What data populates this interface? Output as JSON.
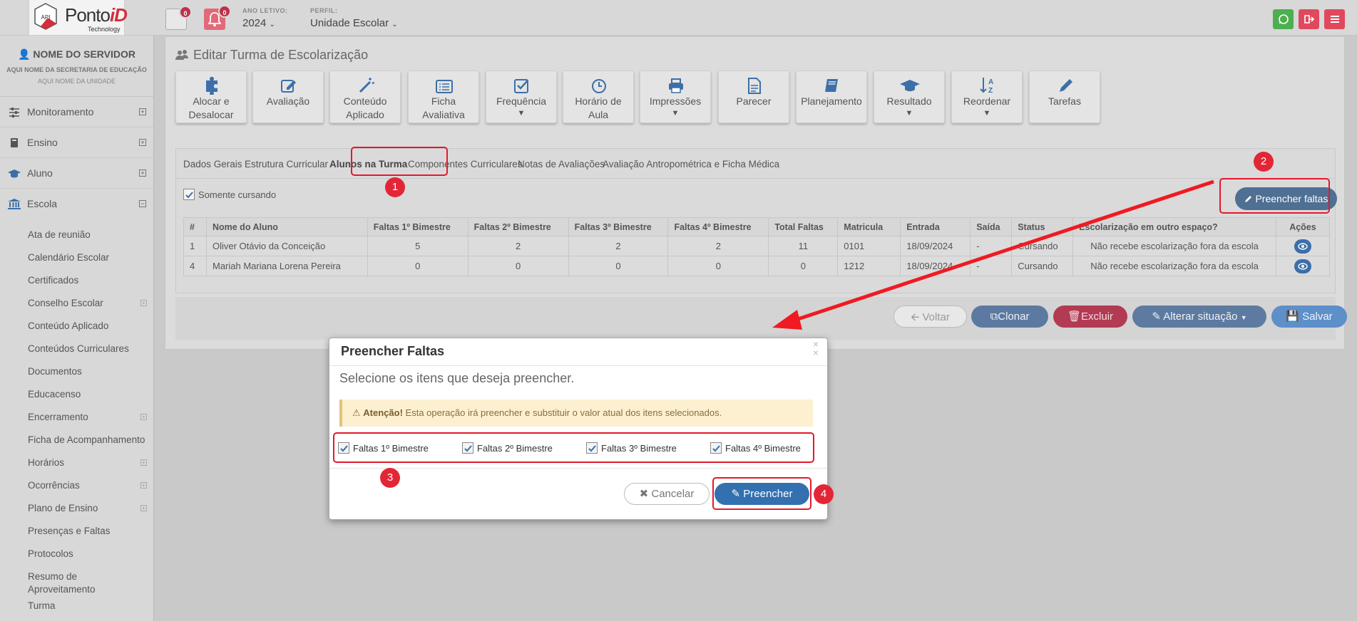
{
  "header": {
    "logo_brand": "Ponto",
    "logo_brand_accent": "iD",
    "logo_sub": "Technology",
    "logo_mark": "API",
    "msg_count": "0",
    "notif_count": "0",
    "year_label": "ANO LETIVO:",
    "year_value": "2024",
    "profile_label": "PERFIL:",
    "profile_value": "Unidade Escolar"
  },
  "sidebar": {
    "user_name": "NOME DO SERVIDOR",
    "secretaria": "AQUI NOME DA SECRETARIA DE EDUCAÇÃO",
    "unidade": "AQUI NOME DA UNIDADE",
    "menu": [
      {
        "label": "Monitoramento",
        "icon": "sliders-icon"
      },
      {
        "label": "Ensino",
        "icon": "book-icon"
      },
      {
        "label": "Aluno",
        "icon": "graduation-cap-icon"
      },
      {
        "label": "Escola",
        "icon": "bank-icon"
      }
    ],
    "submenu": [
      "Ata de reunião",
      "Calendário Escolar",
      "Certificados",
      "Conselho Escolar",
      "Conteúdo Aplicado",
      "Conteúdos Curriculares",
      "Documentos",
      "Educacenso",
      "Encerramento",
      "Ficha de Acompanhamento",
      "Horários",
      "Ocorrências",
      "Plano de Ensino",
      "Presenças e Faltas",
      "Protocolos",
      "Resumo de Aproveitamento",
      "Turma"
    ]
  },
  "page": {
    "title": "Editar Turma de Escolarização",
    "toolbar": [
      {
        "l1": "Alocar e",
        "l2": "Desalocar"
      },
      {
        "l1": "Avaliação",
        "l2": ""
      },
      {
        "l1": "Conteúdo",
        "l2": "Aplicado"
      },
      {
        "l1": "Ficha",
        "l2": "Avaliativa"
      },
      {
        "l1": "Frequência",
        "l2": ""
      },
      {
        "l1": "Horário de",
        "l2": "Aula"
      },
      {
        "l1": "Impressões",
        "l2": ""
      },
      {
        "l1": "Parecer",
        "l2": ""
      },
      {
        "l1": "Planejamento",
        "l2": ""
      },
      {
        "l1": "Resultado",
        "l2": ""
      },
      {
        "l1": "Reordenar",
        "l2": ""
      },
      {
        "l1": "Tarefas",
        "l2": ""
      }
    ],
    "tabs": [
      "Dados Gerais",
      "Estrutura Curricular",
      "Alunos na Turma",
      "Componentes Curriculares",
      "Notas de Avaliações",
      "Avaliação Antropométrica e Ficha Médica"
    ],
    "only_enrolled": "Somente cursando",
    "fill_absences_button": "Preencher faltas",
    "table": {
      "headers": [
        "#",
        "Nome do Aluno",
        "Faltas 1º Bimestre",
        "Faltas 2º Bimestre",
        "Faltas 3º Bimestre",
        "Faltas 4º Bimestre",
        "Total Faltas",
        "Matricula",
        "Entrada",
        "Saída",
        "Status",
        "Escolarização em outro espaço?",
        "Ações"
      ],
      "rows": [
        [
          "1",
          "Oliver Otávio da Conceição",
          "5",
          "2",
          "2",
          "2",
          "11",
          "0101",
          "18/09/2024",
          "-",
          "Cursando",
          "Não recebe escolarização fora da escola"
        ],
        [
          "4",
          "Mariah Mariana Lorena Pereira",
          "0",
          "0",
          "0",
          "0",
          "0",
          "1212",
          "18/09/2024",
          "-",
          "Cursando",
          "Não recebe escolarização fora da escola"
        ]
      ]
    },
    "actions": {
      "back": "Voltar",
      "clone": "Clonar",
      "delete": "Excluir",
      "change_status": "Alterar situação",
      "save": "Salvar"
    }
  },
  "modal": {
    "title": "Preencher Faltas",
    "subtitle": "Selecione os itens que deseja preencher.",
    "warning_strong": "Atenção!",
    "warning_text": "Esta operação irá preencher e substituir o valor atual dos itens selecionados.",
    "options": [
      "Faltas 1º Bimestre",
      "Faltas 2º Bimestre",
      "Faltas 3º Bimestre",
      "Faltas 4º Bimestre"
    ],
    "cancel": "Cancelar",
    "submit": "Preencher"
  },
  "annotations": [
    "1",
    "2",
    "3",
    "4"
  ],
  "colors": {
    "accent_red": "#e3192d",
    "primary_blue": "#3270b0",
    "fill_button": "#4f6f93",
    "delete": "#b23a52"
  }
}
